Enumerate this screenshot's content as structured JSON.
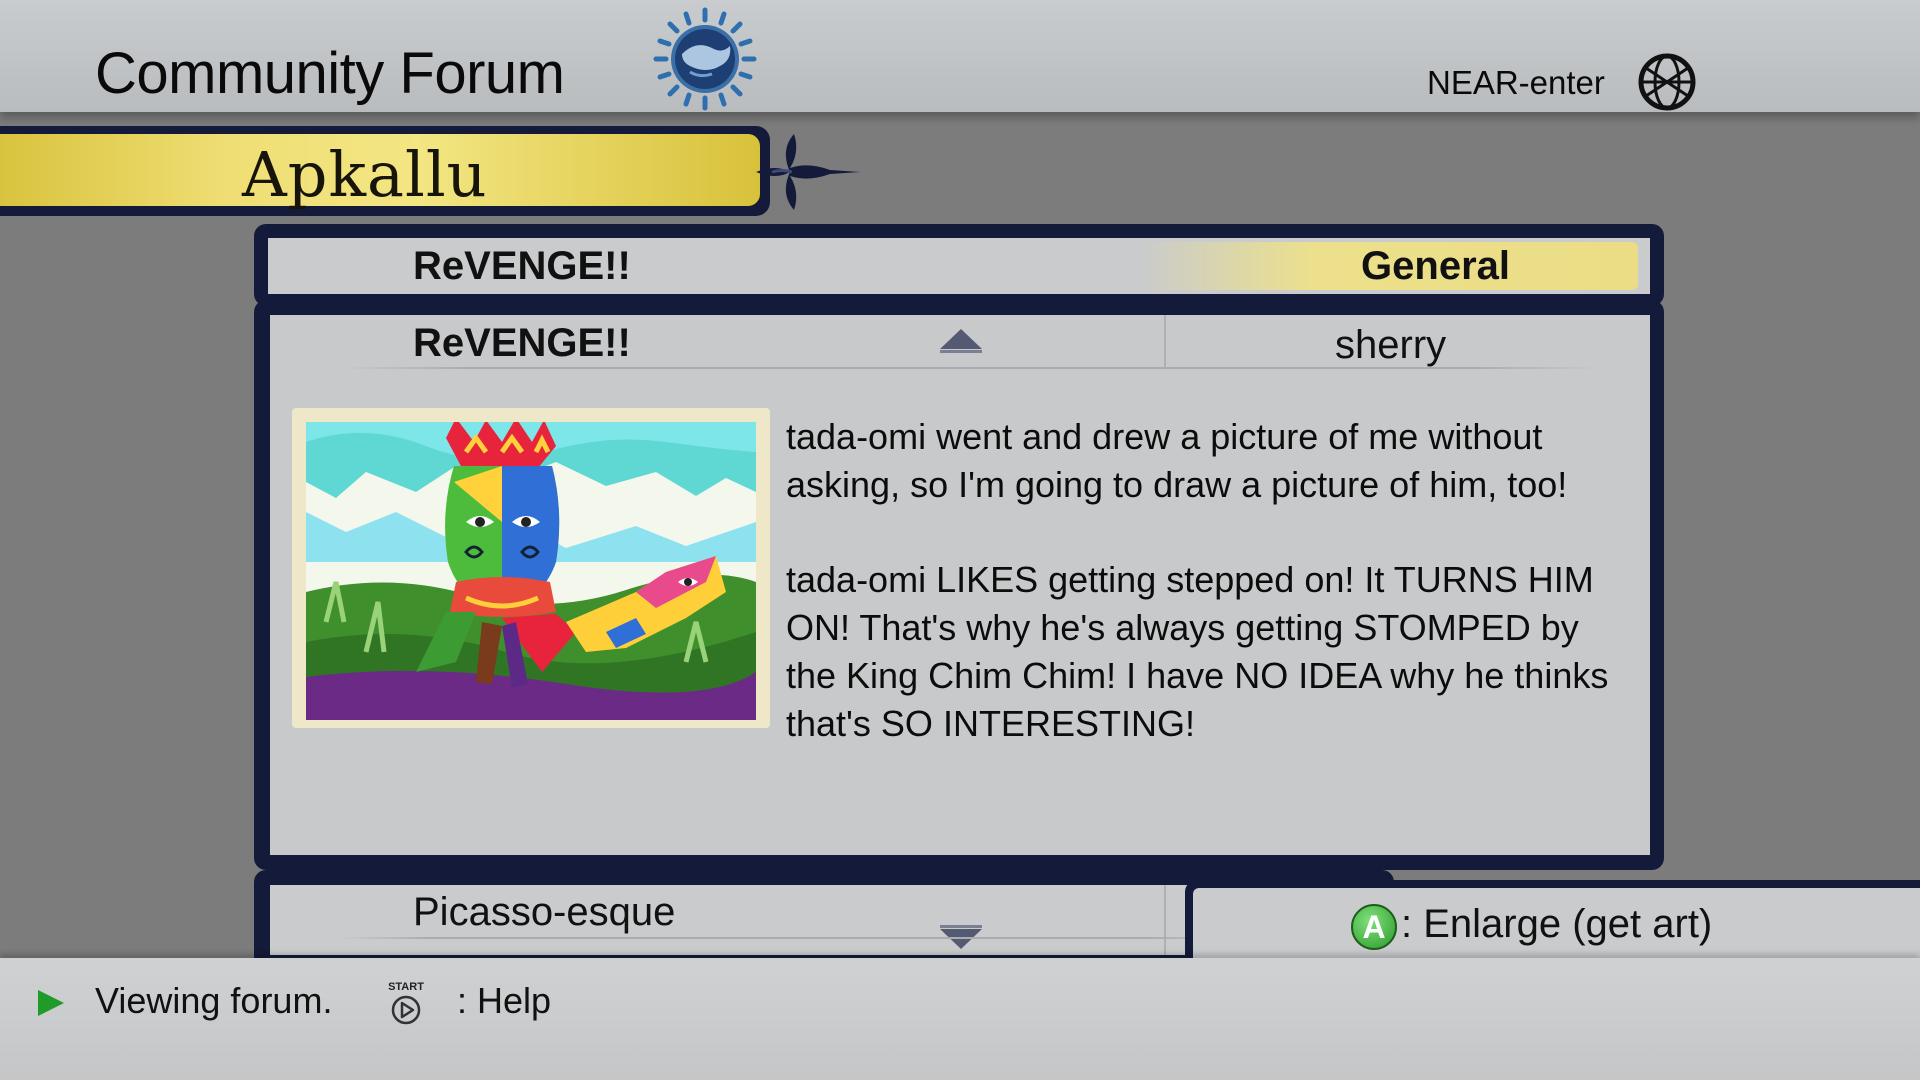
{
  "header": {
    "title": "Community Forum",
    "network_label": "NEAR-enter"
  },
  "forum": {
    "name": "Apkallu"
  },
  "thread": {
    "title": "ReVENGE!!",
    "category": "General"
  },
  "post": {
    "subject": "ReVENGE!!",
    "author": "sherry",
    "paragraphs": [
      "tada-omi went and drew a picture of me without asking, so I'm going to draw a picture of him, too!",
      "tada-omi LIKES getting stepped on! It TURNS HIM ON! That's why he's always getting STOMPED by the King Chim Chim! I have NO IDEA why he thinks that's SO INTERESTING!"
    ]
  },
  "next_thread": {
    "title": "Picasso-esque"
  },
  "hint": {
    "button": "A",
    "label": ": Enlarge (get art)"
  },
  "status": {
    "message": "Viewing forum.",
    "start_label": "START",
    "help_label": ": Help"
  },
  "colors": {
    "frame_navy": "#141a3a",
    "banner_gold": "#efde74",
    "accent_green": "#1f9b2a"
  }
}
